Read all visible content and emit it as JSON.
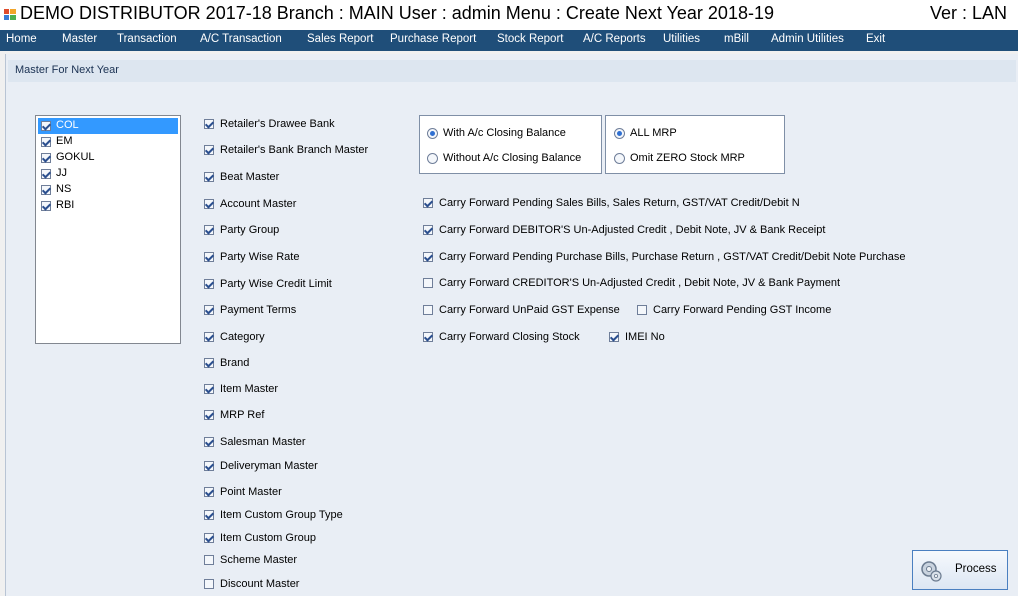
{
  "window": {
    "title": "DEMO DISTRIBUTOR 2017-18 Branch : MAIN User : admin Menu : Create Next Year 2018-19",
    "version": "Ver : LAN"
  },
  "menu": [
    "Home",
    "Master",
    "Transaction",
    "A/C Transaction",
    "Sales Report",
    "Purchase Report",
    "Stock Report",
    "A/C Reports",
    "Utilities",
    "mBill",
    "Admin Utilities",
    "Exit"
  ],
  "panel": {
    "title": "Master For Next Year"
  },
  "companies": [
    {
      "label": "COL",
      "checked": true,
      "selected": true
    },
    {
      "label": "EM",
      "checked": true
    },
    {
      "label": "GOKUL",
      "checked": true
    },
    {
      "label": "JJ",
      "checked": true
    },
    {
      "label": "NS",
      "checked": true
    },
    {
      "label": "RBI",
      "checked": true
    }
  ],
  "masters": [
    {
      "label": "Retailer's Drawee Bank",
      "checked": true
    },
    {
      "label": "Retailer's Bank Branch Master",
      "checked": true
    },
    {
      "label": "Beat Master",
      "checked": true
    },
    {
      "label": "Account Master",
      "checked": true
    },
    {
      "label": "Party Group",
      "checked": true
    },
    {
      "label": "Party Wise Rate",
      "checked": true
    },
    {
      "label": "Party Wise Credit Limit",
      "checked": true
    },
    {
      "label": "Payment Terms",
      "checked": true
    },
    {
      "label": "Category",
      "checked": true
    },
    {
      "label": "Brand",
      "checked": true
    },
    {
      "label": "Item Master",
      "checked": true
    },
    {
      "label": "MRP Ref",
      "checked": true
    },
    {
      "label": "Salesman Master",
      "checked": true
    },
    {
      "label": "Deliveryman Master",
      "checked": true
    },
    {
      "label": "Point Master",
      "checked": true
    },
    {
      "label": "Item Custom Group Type",
      "checked": true
    },
    {
      "label": "Item Custom Group",
      "checked": true
    },
    {
      "label": "Scheme Master",
      "checked": false
    },
    {
      "label": "Discount Master",
      "checked": false
    }
  ],
  "closing_balance": {
    "options": [
      {
        "label": "With A/c Closing Balance",
        "selected": true
      },
      {
        "label": "Without A/c Closing Balance",
        "selected": false
      }
    ]
  },
  "mrp": {
    "options": [
      {
        "label": "ALL MRP",
        "selected": true
      },
      {
        "label": "Omit ZERO Stock MRP",
        "selected": false
      }
    ]
  },
  "carry_forward": [
    {
      "label": "Carry Forward Pending Sales Bills, Sales Return, GST/VAT Credit/Debit N",
      "checked": true
    },
    {
      "label": "Carry Forward DEBITOR'S Un-Adjusted Credit , Debit Note, JV & Bank Receipt",
      "checked": true
    },
    {
      "label": "Carry Forward Pending Purchase Bills, Purchase Return , GST/VAT Credit/Debit Note Purchase",
      "checked": true
    },
    {
      "label": "Carry Forward CREDITOR'S Un-Adjusted Credit , Debit Note, JV & Bank Payment",
      "checked": false
    },
    {
      "label": "Carry Forward UnPaid GST Expense",
      "checked": false
    },
    {
      "label": "Carry Forward Pending GST Income",
      "checked": false
    },
    {
      "label": "Carry Forward Closing Stock",
      "checked": true
    },
    {
      "label": "IMEI No",
      "checked": true
    }
  ],
  "actions": {
    "process_label": "Process"
  }
}
